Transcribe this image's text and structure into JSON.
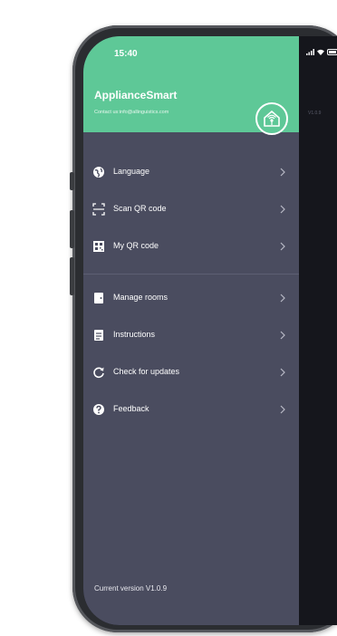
{
  "status_bar": {
    "time": "15:40"
  },
  "header": {
    "app_name": "ApplianceSmart",
    "contact": "Contact us:info@allinguistics.com"
  },
  "menu": [
    {
      "label": "Language",
      "icon": "globe-icon"
    },
    {
      "label": "Scan QR code",
      "icon": "scan-qr-icon"
    },
    {
      "label": "My QR code",
      "icon": "qr-code-icon"
    },
    {
      "label": "Manage rooms",
      "icon": "door-icon"
    },
    {
      "label": "Instructions",
      "icon": "document-icon"
    },
    {
      "label": "Check for updates",
      "icon": "refresh-icon"
    },
    {
      "label": "Feedback",
      "icon": "question-icon"
    }
  ],
  "footer": {
    "version": "Current version V1.0.9"
  },
  "right_pane": {
    "text": "V1.0.9"
  },
  "colors": {
    "header_green": "#5ec897",
    "drawer_bg": "#4a4c5f",
    "screen_dark": "#15161c"
  }
}
